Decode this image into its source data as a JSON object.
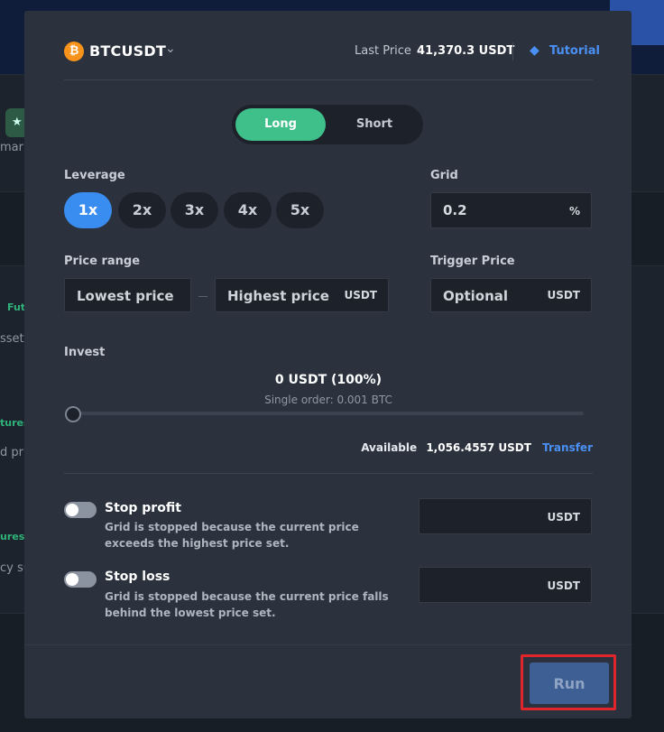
{
  "background": {
    "fragments": [
      "mar",
      "Futu",
      "sset",
      "tures",
      "d pri",
      "ures",
      "cy su"
    ]
  },
  "header": {
    "pair": "BTCUSDT",
    "last_price_label": "Last Price",
    "last_price_value": "41,370.3 USDT",
    "tutorial_label": "Tutorial"
  },
  "direction": {
    "long_label": "Long",
    "short_label": "Short",
    "selected": "Long"
  },
  "leverage": {
    "label": "Leverage",
    "options": [
      "1x",
      "2x",
      "3x",
      "4x",
      "5x"
    ],
    "selected": "1x"
  },
  "grid": {
    "label": "Grid",
    "value": "0.2",
    "unit": "%"
  },
  "price_range": {
    "label": "Price range",
    "lowest_placeholder": "Lowest price",
    "highest_placeholder": "Highest price",
    "unit": "USDT"
  },
  "trigger_price": {
    "label": "Trigger Price",
    "placeholder": "Optional",
    "unit": "USDT"
  },
  "invest": {
    "label": "Invest",
    "amount": "0 USDT (100%)",
    "single_order": "Single order: 0.001 BTC",
    "slider_percent": 0,
    "available_label": "Available",
    "available_value": "1,056.4557 USDT",
    "transfer_label": "Transfer"
  },
  "stop_profit": {
    "title": "Stop profit",
    "description": "Grid is stopped because the current price exceeds the highest price set.",
    "unit": "USDT",
    "enabled": false
  },
  "stop_loss": {
    "title": "Stop loss",
    "description": "Grid is stopped because the current price falls behind the lowest price set.",
    "unit": "USDT",
    "enabled": false
  },
  "run_button": {
    "label": "Run"
  },
  "colors": {
    "accent_green": "#3fc08a",
    "accent_blue": "#3a8df0",
    "link_blue": "#4a90f5",
    "highlight_red": "#e0262c"
  }
}
